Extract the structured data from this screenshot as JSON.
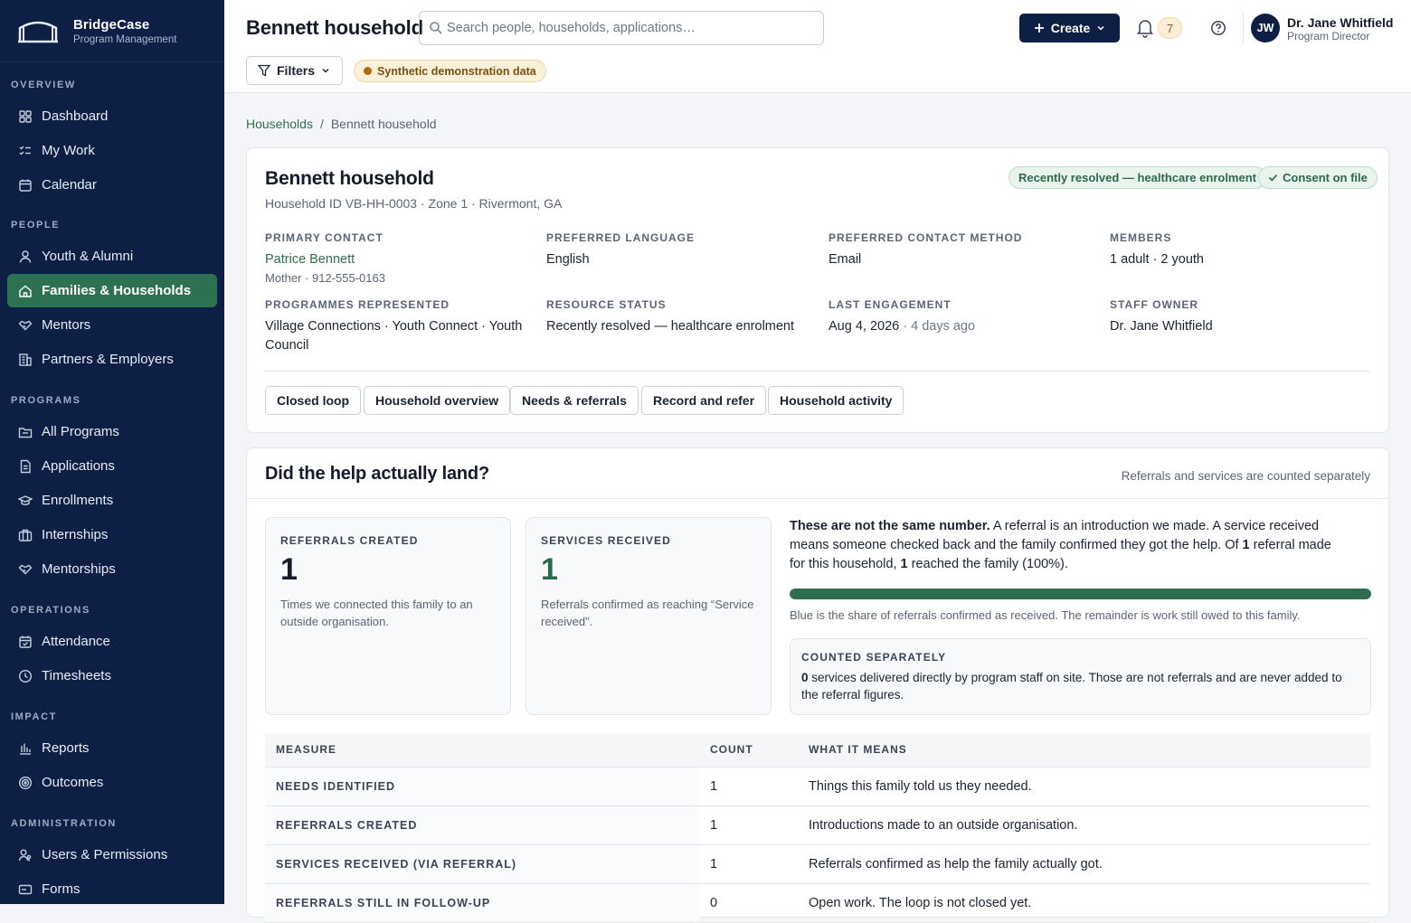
{
  "brand": {
    "name": "BridgeCase",
    "subtitle": "Program Management"
  },
  "sidebar": {
    "sections": [
      {
        "heading": "OVERVIEW",
        "items": [
          {
            "label": "Dashboard",
            "icon": "dashboard-icon"
          },
          {
            "label": "My Work",
            "icon": "checklist-icon"
          },
          {
            "label": "Calendar",
            "icon": "calendar-icon"
          }
        ]
      },
      {
        "heading": "PEOPLE",
        "items": [
          {
            "label": "Youth & Alumni",
            "icon": "person-icon"
          },
          {
            "label": "Families & Households",
            "icon": "home-icon",
            "active": true
          },
          {
            "label": "Mentors",
            "icon": "handshake-icon"
          },
          {
            "label": "Partners & Employers",
            "icon": "building-icon"
          }
        ]
      },
      {
        "heading": "PROGRAMS",
        "items": [
          {
            "label": "All Programs",
            "icon": "folder-icon"
          },
          {
            "label": "Applications",
            "icon": "document-icon"
          },
          {
            "label": "Enrollments",
            "icon": "graduation-cap-icon"
          },
          {
            "label": "Internships",
            "icon": "briefcase-icon"
          },
          {
            "label": "Mentorships",
            "icon": "handshake-icon"
          }
        ]
      },
      {
        "heading": "OPERATIONS",
        "items": [
          {
            "label": "Attendance",
            "icon": "calendar-check-icon"
          },
          {
            "label": "Timesheets",
            "icon": "clock-icon"
          }
        ]
      },
      {
        "heading": "IMPACT",
        "items": [
          {
            "label": "Reports",
            "icon": "bar-chart-icon"
          },
          {
            "label": "Outcomes",
            "icon": "target-icon"
          }
        ]
      },
      {
        "heading": "ADMINISTRATION",
        "items": [
          {
            "label": "Users & Permissions",
            "icon": "users-key-icon"
          },
          {
            "label": "Forms",
            "icon": "form-icon"
          }
        ]
      }
    ]
  },
  "header": {
    "title": "Bennett household",
    "search_placeholder": "Search people, households, applications…",
    "create_label": "Create",
    "notification_count": "7",
    "user": {
      "initials": "JW",
      "name": "Dr. Jane Whitfield",
      "role": "Program Director"
    },
    "filters_label": "Filters",
    "synthetic_badge": "Synthetic demonstration data"
  },
  "breadcrumb": {
    "parent": "Households",
    "separator": "/",
    "current": "Bennett household"
  },
  "household": {
    "title": "Bennett household",
    "meta": "Household ID VB-HH-0003 · Zone 1 · Rivermont, GA",
    "status_pill": "Recently resolved — healthcare enrolment",
    "consent_pill": "Consent on file",
    "fields": {
      "primary_contact": {
        "label": "PRIMARY CONTACT",
        "value": "Patrice Bennett",
        "sub": "Mother · 912-555-0163"
      },
      "preferred_language": {
        "label": "PREFERRED LANGUAGE",
        "value": "English"
      },
      "preferred_contact": {
        "label": "PREFERRED CONTACT METHOD",
        "value": "Email"
      },
      "members": {
        "label": "MEMBERS",
        "value": "1 adult · 2 youth"
      },
      "programmes": {
        "label": "PROGRAMMES REPRESENTED",
        "value": "Village Connections · Youth Connect · Youth Council"
      },
      "resource_status": {
        "label": "RESOURCE STATUS",
        "value": "Recently resolved — healthcare enrolment"
      },
      "last_engagement": {
        "label": "LAST ENGAGEMENT",
        "value": "Aug 4, 2026",
        "sub": "· 4 days ago"
      },
      "staff_owner": {
        "label": "STAFF OWNER",
        "value": "Dr. Jane Whitfield"
      }
    },
    "tabs": [
      "Closed loop",
      "Household overview",
      "Needs & referrals",
      "Record and refer",
      "Household activity"
    ]
  },
  "help": {
    "title": "Did the help actually land?",
    "note": "Referrals and services are counted separately",
    "referrals": {
      "label": "REFERRALS CREATED",
      "value": "1",
      "desc": "Times we connected this family to an outside organisation."
    },
    "services": {
      "label": "SERVICES RECEIVED",
      "value": "1",
      "desc": "Referrals confirmed as reaching “Service received”."
    },
    "explain": {
      "lead": "These are not the same number.",
      "text1": " A referral is an introduction we made. A service received means someone checked back and the family confirmed they got the help. Of ",
      "n1": "1",
      "text2": " referral made for this household, ",
      "n2": "1",
      "text3": " reached the family (100%)."
    },
    "progress_fraction": 1.0,
    "progress_caption": "Blue is the share of referrals confirmed as received. The remainder is work still owed to this family.",
    "separate": {
      "label": "COUNTED SEPARATELY",
      "count": "0",
      "text": " services delivered directly by program staff on site. Those are not referrals and are never added to the referral figures."
    },
    "table": {
      "headers": [
        "MEASURE",
        "COUNT",
        "WHAT IT MEANS"
      ],
      "rows": [
        [
          "NEEDS IDENTIFIED",
          "1",
          "Things this family told us they needed."
        ],
        [
          "REFERRALS CREATED",
          "1",
          "Introductions made to an outside organisation."
        ],
        [
          "SERVICES RECEIVED (VIA REFERRAL)",
          "1",
          "Referrals confirmed as help the family actually got."
        ],
        [
          "REFERRALS STILL IN FOLLOW-UP",
          "0",
          "Open work. The loop is not closed yet."
        ]
      ]
    }
  }
}
